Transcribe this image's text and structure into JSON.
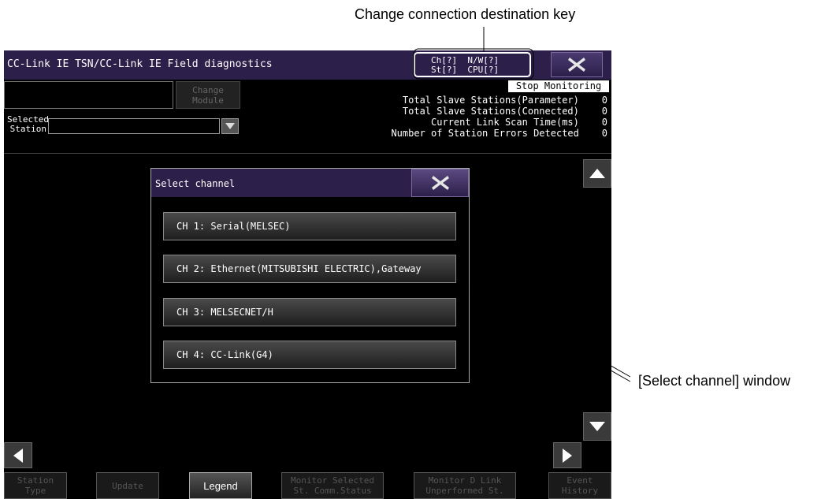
{
  "callouts": {
    "connection_key": "Change connection destination key",
    "select_window": "[Select channel] window"
  },
  "header": {
    "title": "CC-Link IE TSN/CC-Link IE Field diagnostics",
    "conn_line1": "Ch[?]  N/W[?]",
    "conn_line2": "St[?]  CPU[?]",
    "close_icon": "close-x-icon"
  },
  "module": {
    "change_module": "Change\nModule",
    "selected_station_label": "Selected\nStation",
    "selected_station_value": ""
  },
  "stats": {
    "stop_monitoring": "Stop Monitoring",
    "rows": [
      "Total Slave Stations(Parameter)    0",
      "Total Slave Stations(Connected)    0",
      "Current Link Scan Time(ms)    0",
      "Number of Station Errors Detected    0"
    ]
  },
  "dialog": {
    "title": "Select channel",
    "channels": [
      "CH 1: Serial(MELSEC)",
      "CH 2: Ethernet(MITSUBISHI ELECTRIC),Gateway",
      "CH 3: MELSECNET/H",
      "CH 4: CC-Link(G4)"
    ]
  },
  "bottom": {
    "buttons": [
      "Station\nType",
      "Update",
      "Legend",
      "Monitor Selected\nSt. Comm.Status",
      "Monitor D Link\nUnperformed St.",
      "Event\nHistory"
    ]
  }
}
